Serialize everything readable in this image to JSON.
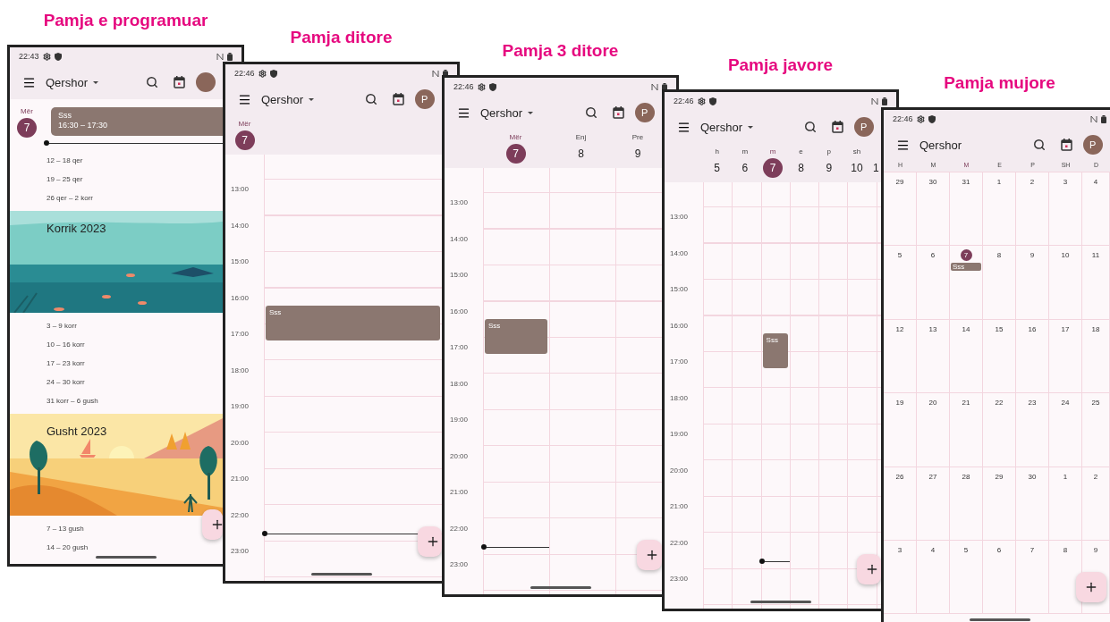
{
  "views": [
    {
      "kind": "schedule",
      "label": "Pamja e programuar",
      "status_time": "22:43",
      "title": "Qershor",
      "has_dropdown": true,
      "avatar": true,
      "day": {
        "weekday": "Mër",
        "date": "7",
        "selected": true
      },
      "event": {
        "title": "Sss",
        "time": "16:30 – 17:30"
      },
      "items": [
        {
          "kind": "range",
          "text": "12 – 18 qer"
        },
        {
          "kind": "range",
          "text": "19 – 25 qer"
        },
        {
          "kind": "range",
          "text": "26 qer – 2 korr"
        },
        {
          "kind": "banner",
          "text": "Korrik 2023"
        },
        {
          "kind": "range",
          "text": "3 – 9 korr"
        },
        {
          "kind": "range",
          "text": "10 – 16 korr"
        },
        {
          "kind": "range",
          "text": "17 – 23 korr"
        },
        {
          "kind": "range",
          "text": "24 – 30 korr"
        },
        {
          "kind": "range",
          "text": "31 korr – 6 gush"
        },
        {
          "kind": "banner",
          "text": "Gusht 2023"
        },
        {
          "kind": "range",
          "text": "7 – 13 gush"
        },
        {
          "kind": "range",
          "text": "14 – 20 gush"
        }
      ]
    },
    {
      "kind": "day",
      "label": "Pamja ditore",
      "status_time": "22:46",
      "title": "Qershor",
      "has_dropdown": true,
      "avatar_letter": "P",
      "days": [
        {
          "weekday": "Mër",
          "date": "7",
          "selected": true,
          "events": [
            "Sss"
          ]
        }
      ],
      "hours": [
        "13:00",
        "14:00",
        "15:00",
        "16:00",
        "17:00",
        "18:00",
        "19:00",
        "20:00",
        "21:00",
        "22:00",
        "23:00"
      ]
    },
    {
      "kind": "three_day",
      "label": "Pamja 3 ditore",
      "status_time": "22:46",
      "title": "Qershor",
      "has_dropdown": true,
      "avatar_letter": "P",
      "days": [
        {
          "weekday": "Mër",
          "date": "7",
          "selected": true,
          "events": [
            "Sss"
          ]
        },
        {
          "weekday": "Enj",
          "date": "8",
          "selected": false
        },
        {
          "weekday": "Pre",
          "date": "9",
          "selected": false
        }
      ],
      "hours": [
        "13:00",
        "14:00",
        "15:00",
        "16:00",
        "17:00",
        "18:00",
        "19:00",
        "20:00",
        "21:00",
        "22:00",
        "23:00"
      ]
    },
    {
      "kind": "week",
      "label": "Pamja javore",
      "status_time": "22:46",
      "title": "Qershor",
      "has_dropdown": true,
      "avatar_letter": "P",
      "days": [
        {
          "weekday": "h",
          "date": "5",
          "selected": false
        },
        {
          "weekday": "m",
          "date": "6",
          "selected": false
        },
        {
          "weekday": "m",
          "date": "7",
          "selected": true,
          "events": [
            "Sss"
          ]
        },
        {
          "weekday": "e",
          "date": "8",
          "selected": false
        },
        {
          "weekday": "p",
          "date": "9",
          "selected": false
        },
        {
          "weekday": "sh",
          "date": "10",
          "selected": false
        },
        {
          "date": "1",
          "selected": false
        }
      ],
      "hours": [
        "13:00",
        "14:00",
        "15:00",
        "16:00",
        "17:00",
        "18:00",
        "19:00",
        "20:00",
        "21:00",
        "22:00",
        "23:00"
      ]
    },
    {
      "kind": "month",
      "label": "Pamja mujore",
      "status_time": "22:46",
      "title": "Qershor",
      "has_dropdown": false,
      "avatar_letter": "P",
      "weekdays": [
        {
          "text": "H",
          "selected": false
        },
        {
          "text": "M",
          "selected": false
        },
        {
          "text": "M",
          "selected": true
        },
        {
          "text": "E",
          "selected": false
        },
        {
          "text": "P",
          "selected": false
        },
        {
          "text": "SH",
          "selected": false
        },
        {
          "text": "D",
          "selected": false
        }
      ],
      "weeks": [
        [
          {
            "date": "29",
            "selected": false
          },
          {
            "date": "30",
            "selected": false
          },
          {
            "date": "31",
            "selected": false
          },
          {
            "date": "1",
            "selected": false
          },
          {
            "date": "2",
            "selected": false
          },
          {
            "date": "3",
            "selected": false
          },
          {
            "date": "4",
            "selected": false
          }
        ],
        [
          {
            "date": "5",
            "selected": false
          },
          {
            "date": "6",
            "selected": false
          },
          {
            "date": "7",
            "selected": true,
            "events": [
              "Sss"
            ]
          },
          {
            "date": "8",
            "selected": false
          },
          {
            "date": "9",
            "selected": false
          },
          {
            "date": "10",
            "selected": false
          },
          {
            "date": "11",
            "selected": false
          }
        ],
        [
          {
            "date": "12",
            "selected": false
          },
          {
            "date": "13",
            "selected": false
          },
          {
            "date": "14",
            "selected": false
          },
          {
            "date": "15",
            "selected": false
          },
          {
            "date": "16",
            "selected": false
          },
          {
            "date": "17",
            "selected": false
          },
          {
            "date": "18",
            "selected": false
          }
        ],
        [
          {
            "date": "19",
            "selected": false
          },
          {
            "date": "20",
            "selected": false
          },
          {
            "date": "21",
            "selected": false
          },
          {
            "date": "22",
            "selected": false
          },
          {
            "date": "23",
            "selected": false
          },
          {
            "date": "24",
            "selected": false
          },
          {
            "date": "25",
            "selected": false
          }
        ],
        [
          {
            "date": "26",
            "selected": false
          },
          {
            "date": "27",
            "selected": false
          },
          {
            "date": "28",
            "selected": false
          },
          {
            "date": "29",
            "selected": false
          },
          {
            "date": "30",
            "selected": false
          },
          {
            "date": "1",
            "selected": false
          },
          {
            "date": "2",
            "selected": false
          }
        ],
        [
          {
            "date": "3",
            "selected": false
          },
          {
            "date": "4",
            "selected": false
          },
          {
            "date": "5",
            "selected": false
          },
          {
            "date": "6",
            "selected": false
          },
          {
            "date": "7",
            "selected": false
          },
          {
            "date": "8",
            "selected": false
          },
          {
            "date": "9",
            "selected": false
          }
        ]
      ]
    }
  ]
}
